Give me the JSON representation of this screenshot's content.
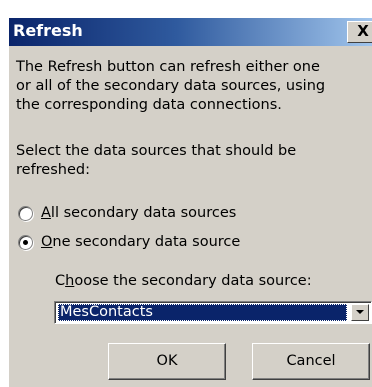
{
  "window": {
    "title": "Refresh",
    "close_glyph": "X"
  },
  "description": {
    "lines": [
      "The Refresh button can refresh either one",
      "or all of the secondary data sources, using",
      "the corresponding data connections."
    ]
  },
  "prompt": {
    "lines": [
      "Select the data sources that should be",
      "refreshed:"
    ]
  },
  "options": {
    "all": {
      "mnemonic": "A",
      "rest": "ll secondary data sources",
      "checked": false
    },
    "one": {
      "mnemonic": "O",
      "rest": "ne secondary data source",
      "checked": true
    }
  },
  "source_select": {
    "label_before": "C",
    "label_mnemonic": "h",
    "label_after": "oose the secondary data source:",
    "value": "MesContacts"
  },
  "buttons": {
    "ok": "OK",
    "cancel": "Cancel"
  },
  "icons": {
    "close": "close-icon",
    "dropdown": "chevron-down-icon",
    "radio": "radio-button"
  },
  "colors": {
    "title_bar_start": "#0a246a",
    "title_bar_end": "#a6caf0",
    "dialog_face": "#d4d0c8",
    "selection": "#0a246a"
  }
}
